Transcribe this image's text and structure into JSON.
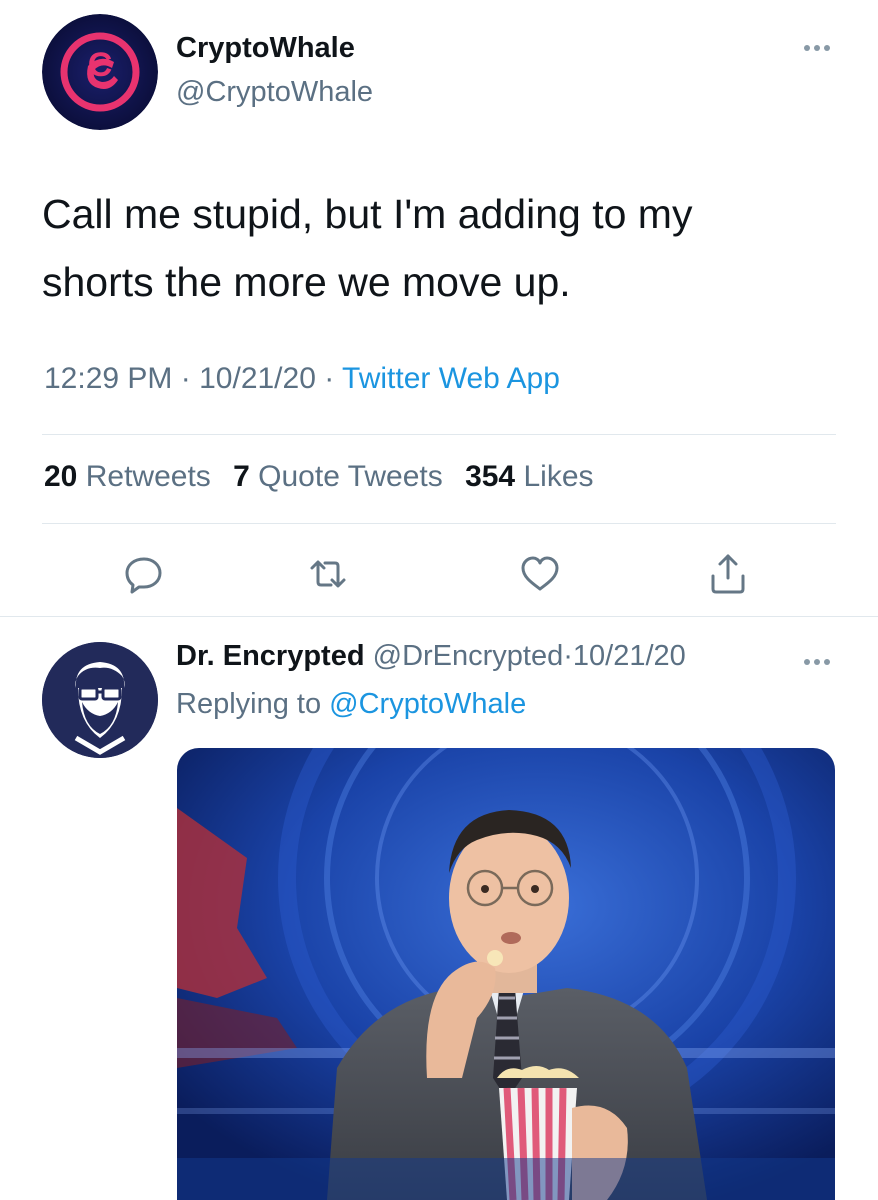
{
  "tweet": {
    "author_name": "CryptoWhale",
    "author_handle": "@CryptoWhale",
    "text_line1": "Call me stupid, but I'm adding to my",
    "text_line2": "shorts the more we move up.",
    "time": "12:29 PM",
    "date": "10/21/20",
    "separator": "·",
    "source": "Twitter Web App",
    "retweets_count": "20",
    "retweets_label": "Retweets",
    "quotes_count": "7",
    "quotes_label": "Quote Tweets",
    "likes_count": "354",
    "likes_label": "Likes"
  },
  "reply": {
    "author_name": "Dr. Encrypted",
    "author_handle": "@DrEncrypted",
    "separator": "·",
    "date": "10/21/20",
    "replying_label": "Replying to",
    "replying_handle": "@CryptoWhale"
  },
  "icons": [
    "more-icon",
    "reply-icon",
    "retweet-icon",
    "like-icon",
    "share-icon"
  ],
  "colors": {
    "link_blue": "#1b95e0",
    "secondary_gray": "#5b7083",
    "text": "#0f1419",
    "divider": "#e1e8ed",
    "avatar_pink": "#e8336f",
    "avatar_navy": "#222a5a"
  }
}
